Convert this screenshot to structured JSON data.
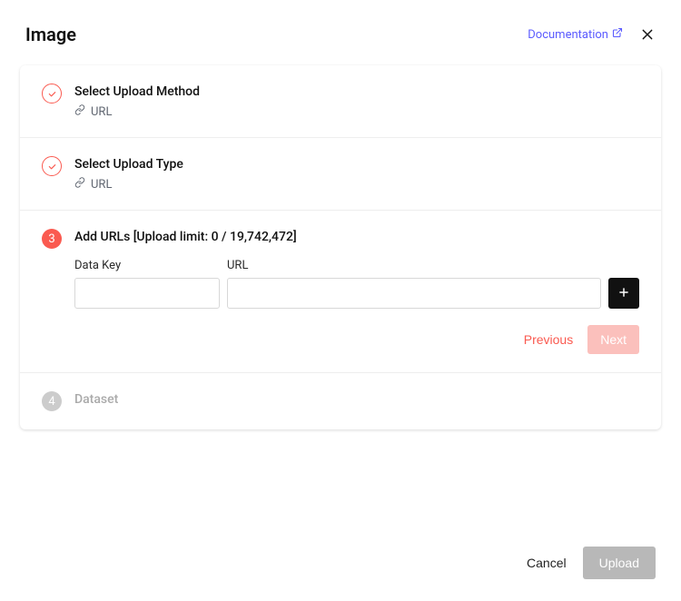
{
  "header": {
    "title": "Image",
    "documentation_label": "Documentation"
  },
  "steps": {
    "step1": {
      "title": "Select Upload Method",
      "sub": "URL"
    },
    "step2": {
      "title": "Select Upload Type",
      "sub": "URL"
    },
    "step3": {
      "number": "3",
      "title": "Add URLs [Upload limit: 0 / 19,742,472]",
      "datakey_label": "Data Key",
      "url_label": "URL",
      "previous_label": "Previous",
      "next_label": "Next"
    },
    "step4": {
      "number": "4",
      "title": "Dataset"
    }
  },
  "footer": {
    "cancel_label": "Cancel",
    "upload_label": "Upload"
  }
}
